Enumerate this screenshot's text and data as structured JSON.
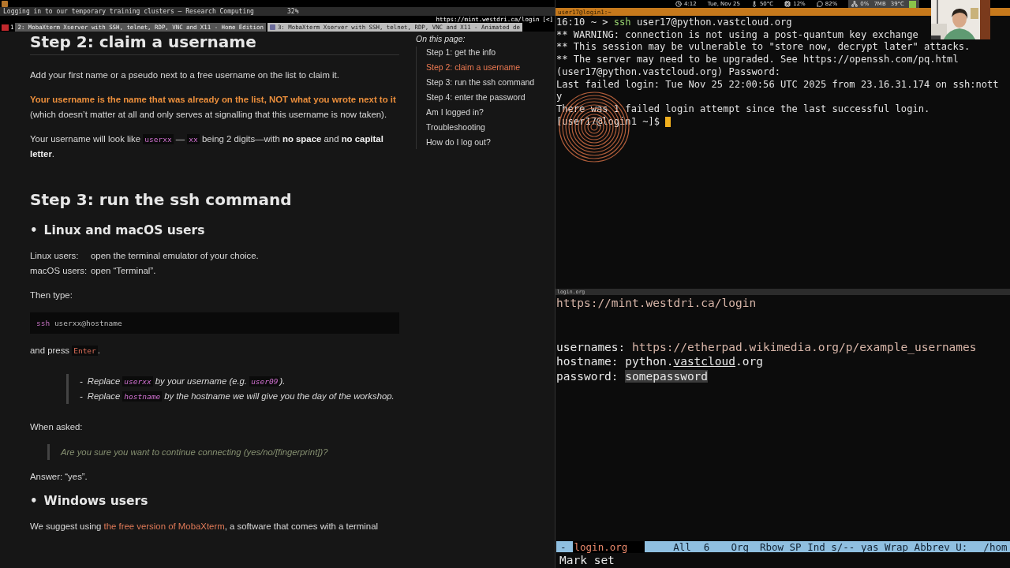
{
  "window": {
    "title": "Logging in to our temporary training clusters — Research Computing",
    "progress": "32%"
  },
  "browser": {
    "url": "https://mint.westdri.ca/login",
    "url_suffix": "[<]",
    "workspace": "1",
    "tabs": [
      {
        "label": "2: MobaXterm Xserver with SSH, telnet, RDP, VNC and X11 - Home Edition",
        "selected": true
      },
      {
        "label": "3: MobaXterm Xserver with SSH, telnet, RDP, VNC and X11 - Animated de",
        "selected": false
      }
    ]
  },
  "status_bar": {
    "items": [
      {
        "kind": "clock",
        "text": "4:12"
      },
      {
        "kind": "date",
        "text": "Tue, Nov 25"
      },
      {
        "kind": "temperature",
        "text": "50°C"
      },
      {
        "kind": "cpu",
        "text": "12%"
      },
      {
        "kind": "memory",
        "text": "82%"
      }
    ],
    "tray": [
      {
        "kind": "network",
        "text": "0%"
      },
      {
        "kind": "plain",
        "text": "7MB"
      },
      {
        "kind": "plain",
        "text": "39°C"
      }
    ]
  },
  "doc": {
    "blocks": [
      {
        "kind": "h2",
        "text": "Step 2: claim a username"
      },
      {
        "kind": "p",
        "segments": [
          {
            "kind": "plain",
            "text": "Add your first name or a pseudo next to a free username on the list to claim it."
          }
        ]
      },
      {
        "kind": "p",
        "segments": [
          {
            "kind": "accent",
            "text": "Your username is the name that was already on the list, NOT what you wrote next to it"
          },
          {
            "kind": "plain",
            "text": " (which doesn’t matter at all and only serves at signalling that this username is now taken)."
          }
        ]
      },
      {
        "kind": "p",
        "segments": [
          {
            "kind": "plain",
            "text": "Your username will look like "
          },
          {
            "kind": "code",
            "text": "userxx"
          },
          {
            "kind": "plain",
            "text": " — "
          },
          {
            "kind": "code",
            "text": "xx"
          },
          {
            "kind": "plain",
            "text": " being 2 digits—with "
          },
          {
            "kind": "strong",
            "text": "no space"
          },
          {
            "kind": "plain",
            "text": " and "
          },
          {
            "kind": "strong",
            "text": "no capital letter"
          },
          {
            "kind": "plain",
            "text": "."
          }
        ]
      },
      {
        "kind": "h2",
        "text": "Step 3: run the ssh command"
      },
      {
        "kind": "h3",
        "bullet": "•",
        "text": "Linux and macOS users"
      },
      {
        "kind": "defs",
        "items": [
          {
            "term": "Linux users:",
            "desc": "open the terminal emulator of your choice."
          },
          {
            "term": "macOS users:",
            "desc": "open “Terminal”."
          }
        ]
      },
      {
        "kind": "p",
        "segments": [
          {
            "kind": "plain",
            "text": "Then type:"
          }
        ]
      },
      {
        "kind": "code",
        "segments": [
          {
            "kind": "keyword",
            "text": "ssh"
          },
          {
            "kind": "plain",
            "text": " userxx@hostname"
          }
        ]
      },
      {
        "kind": "p",
        "segments": [
          {
            "kind": "plain",
            "text": "and press "
          },
          {
            "kind": "kbd",
            "text": "Enter"
          },
          {
            "kind": "plain",
            "text": "."
          }
        ]
      },
      {
        "kind": "notes",
        "items": [
          {
            "bullet": "-",
            "segments": [
              {
                "kind": "plain",
                "text": "Replace "
              },
              {
                "kind": "code",
                "text": "userxx"
              },
              {
                "kind": "plain",
                "text": " by your username (e.g. "
              },
              {
                "kind": "code",
                "text": "user09"
              },
              {
                "kind": "plain",
                "text": ")."
              }
            ]
          },
          {
            "bullet": "-",
            "segments": [
              {
                "kind": "plain",
                "text": "Replace "
              },
              {
                "kind": "code",
                "text": "hostname"
              },
              {
                "kind": "plain",
                "text": " by the hostname we will give you the day of the workshop."
              }
            ]
          }
        ]
      },
      {
        "kind": "p",
        "segments": [
          {
            "kind": "plain",
            "text": "When asked:"
          }
        ]
      },
      {
        "kind": "quote",
        "text": "Are you sure you want to continue connecting (yes/no/[fingerprint])?"
      },
      {
        "kind": "p",
        "segments": [
          {
            "kind": "plain",
            "text": "Answer: “yes”."
          }
        ]
      },
      {
        "kind": "h3",
        "bullet": "•",
        "text": "Windows users"
      },
      {
        "kind": "p",
        "segments": [
          {
            "kind": "plain",
            "text": "We suggest using "
          },
          {
            "kind": "link",
            "text": "the free version of MobaXterm"
          },
          {
            "kind": "plain",
            "text": ", a software that comes with a terminal"
          }
        ]
      }
    ],
    "toc": {
      "title": "On this page:",
      "items": [
        {
          "label": "Step 1: get the info",
          "selected": false
        },
        {
          "label": "Step 2: claim a username",
          "selected": true
        },
        {
          "label": "Step 3: run the ssh command",
          "selected": false
        },
        {
          "label": "Step 4: enter the password",
          "selected": false
        },
        {
          "label": "Am I logged in?",
          "selected": false
        },
        {
          "label": "Troubleshooting",
          "selected": false
        },
        {
          "label": "How do I log out?",
          "selected": false
        }
      ]
    }
  },
  "terminal": {
    "title": "user17@login1:~",
    "lines": [
      {
        "kind": "command",
        "prefix": "16:10 ~ > ",
        "command": "ssh",
        "args": " user17@python.vastcloud.org"
      },
      {
        "kind": "text",
        "text": "** WARNING: connection is not using a post-quantum key exchange"
      },
      {
        "kind": "text",
        "text": "** This session may be vulnerable to \"store now, decrypt later\" attacks."
      },
      {
        "kind": "text",
        "text": "** The server may need to be upgraded. See https://openssh.com/pq.html"
      },
      {
        "kind": "text",
        "text": "(user17@python.vastcloud.org) Password:"
      },
      {
        "kind": "text",
        "text": "Last failed login: Tue Nov 25 22:00:56 UTC 2025 from 23.16.31.174 on ssh:nott"
      },
      {
        "kind": "text",
        "text": "y"
      },
      {
        "kind": "text",
        "text": "There was 1 failed login attempt since the last successful login."
      },
      {
        "kind": "prompt",
        "text": "[user17@login1 ~]$ ",
        "cursor": true
      }
    ]
  },
  "editor": {
    "file_tab": "login.org",
    "url": "https://mint.westdri.ca/login",
    "fields": [
      {
        "key": "usernames:",
        "segments": [
          {
            "kind": "link",
            "text": "https://etherpad.wikimedia.org/p/example_usernames"
          }
        ]
      },
      {
        "key": "hostname:",
        "segments": [
          {
            "kind": "plain",
            "text": "python."
          },
          {
            "kind": "underline",
            "text": "vastcloud"
          },
          {
            "kind": "plain",
            "text": ".org"
          }
        ]
      },
      {
        "key": "password:",
        "segments": [
          {
            "kind": "region",
            "text": "somepassword"
          }
        ]
      }
    ],
    "modeline": {
      "modified": "-",
      "buffer": "login.org",
      "position": "All",
      "line": "6",
      "mode": "Org",
      "minor": "Rbow SP Ind s/-- yas Wrap Abbrev U:",
      "path": "/hom"
    },
    "minibuffer": "Mark set"
  }
}
